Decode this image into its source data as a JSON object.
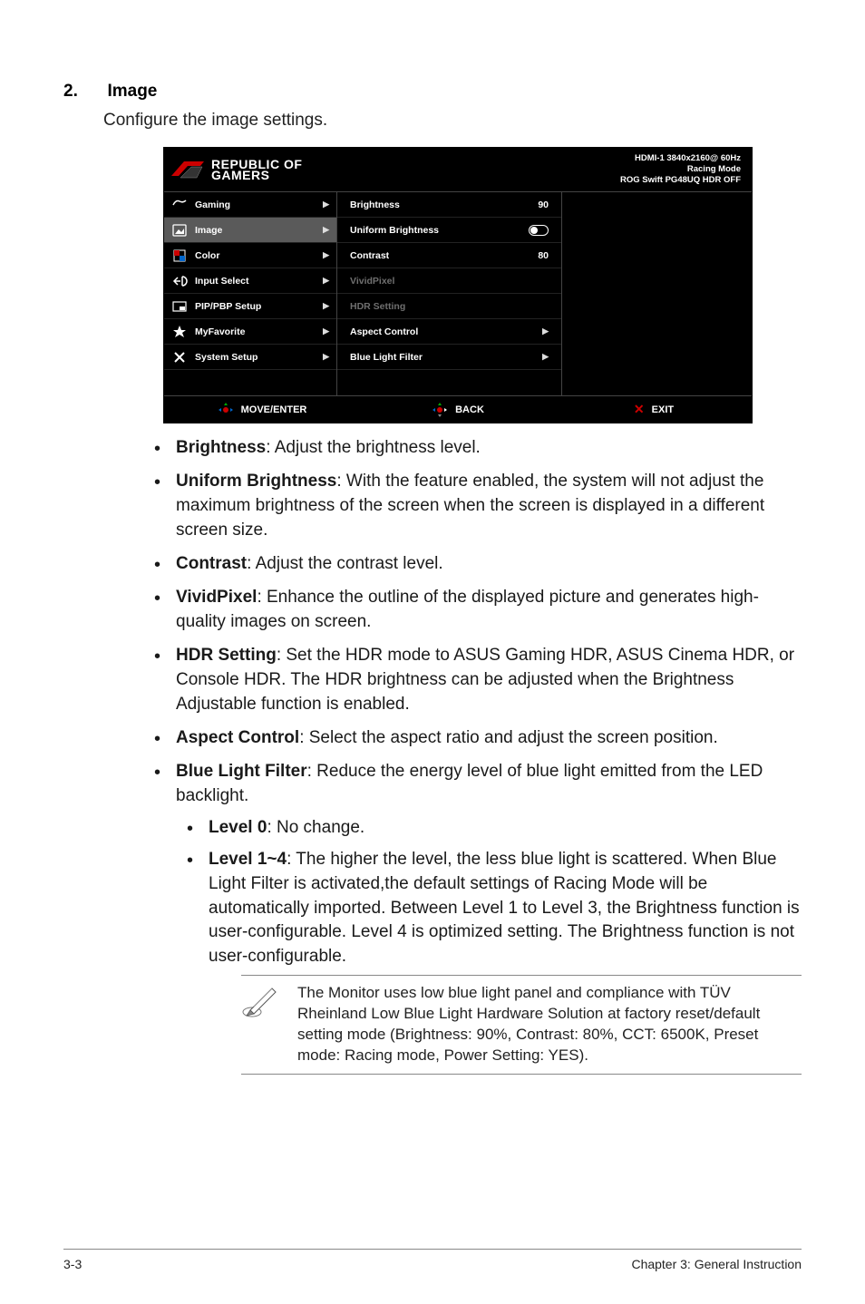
{
  "section": {
    "number": "2.",
    "title": "Image",
    "subtitle": "Configure the image settings."
  },
  "osd": {
    "brand_line1": "REPUBLIC OF",
    "brand_line2": "GAMERS",
    "status_line1": "HDMI-1 3840x2160@ 60Hz",
    "status_line2": "Racing Mode",
    "status_line3": "ROG Swift  PG48UQ   HDR OFF",
    "nav": [
      {
        "label": "Gaming",
        "icon": "gaming-icon"
      },
      {
        "label": "Image",
        "icon": "image-icon",
        "selected": true
      },
      {
        "label": "Color",
        "icon": "color-icon"
      },
      {
        "label": "Input Select",
        "icon": "input-icon"
      },
      {
        "label": "PIP/PBP Setup",
        "icon": "pip-icon"
      },
      {
        "label": "MyFavorite",
        "icon": "star-icon"
      },
      {
        "label": "System Setup",
        "icon": "tools-icon"
      }
    ],
    "items": [
      {
        "label": "Brightness",
        "value": "90",
        "kind": "value"
      },
      {
        "label": "Uniform Brightness",
        "value": "",
        "kind": "toggle"
      },
      {
        "label": "Contrast",
        "value": "80",
        "kind": "value"
      },
      {
        "label": "VividPixel",
        "value": "",
        "kind": "disabled"
      },
      {
        "label": "HDR Setting",
        "value": "",
        "kind": "disabled"
      },
      {
        "label": "Aspect Control",
        "value": "",
        "kind": "submenu"
      },
      {
        "label": "Blue Light Filter",
        "value": "",
        "kind": "submenu"
      }
    ],
    "footer": {
      "move": "MOVE/ENTER",
      "back": "BACK",
      "exit": "EXIT"
    }
  },
  "bullets": [
    {
      "strong": "Brightness",
      "text": ": Adjust the brightness level."
    },
    {
      "strong": "Uniform Brightness",
      "text": ": With the feature enabled, the system will not adjust the maximum brightness of the screen when the screen is displayed in a different screen size."
    },
    {
      "strong": "Contrast",
      "text": ": Adjust the contrast level."
    },
    {
      "strong": "VividPixel",
      "text": ": Enhance the outline of the displayed picture and generates high-quality images on screen."
    },
    {
      "strong": "HDR Setting",
      "text": ": Set the HDR mode to ASUS Gaming HDR, ASUS Cinema HDR, or Console HDR. The HDR brightness can be adjusted when the Brightness Adjustable function is enabled."
    },
    {
      "strong": "Aspect Control",
      "text": ": Select the aspect ratio and adjust the screen position."
    },
    {
      "strong": "Blue Light Filter",
      "text": ": Reduce the energy level of blue light emitted from the LED backlight."
    }
  ],
  "sub_bullets": [
    {
      "strong": "Level 0",
      "text": ": No change."
    },
    {
      "strong": "Level 1~4",
      "text": ": The higher the level, the less blue light is scattered. When Blue Light Filter is activated,the default settings of Racing Mode will be automatically imported. Between Level 1 to Level 3, the Brightness function is user-configurable. Level 4 is optimized setting. The Brightness function is not user-configurable."
    }
  ],
  "note": "The Monitor uses low blue light panel and compliance with TÜV Rheinland Low Blue Light Hardware Solution at factory reset/default setting mode (Brightness: 90%, Contrast: 80%, CCT: 6500K, Preset mode: Racing mode, Power Setting: YES).",
  "footer": {
    "left": "3-3",
    "right": "Chapter 3: General Instruction"
  }
}
